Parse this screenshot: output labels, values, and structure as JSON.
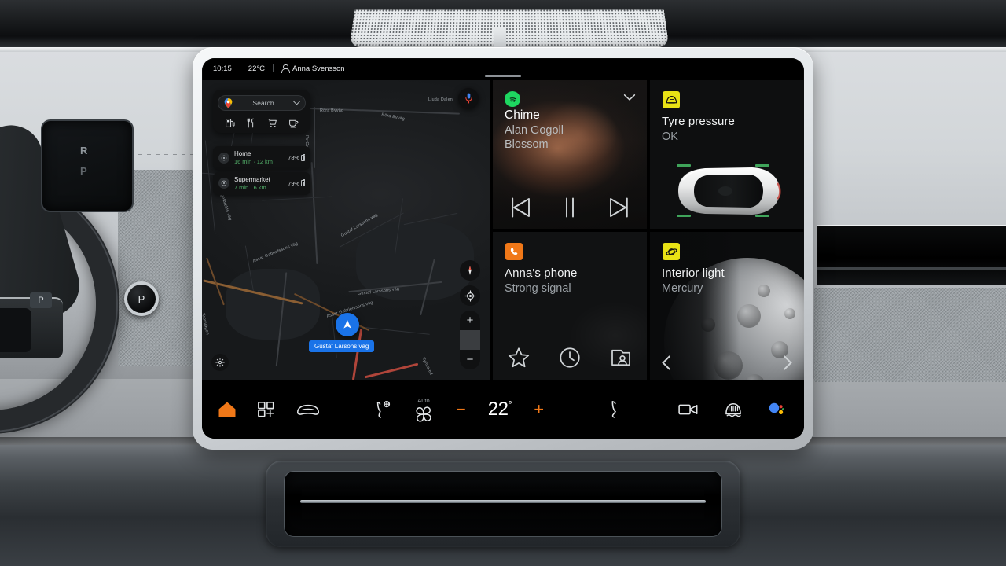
{
  "status_bar": {
    "time": "10:15",
    "temperature": "22°C",
    "profile_name": "Anna Svensson",
    "profile_icon": "person-icon"
  },
  "map": {
    "search": {
      "placeholder": "Search",
      "pin_icon": "google-maps-pin-icon",
      "chevron_icon": "chevron-down-icon"
    },
    "categories": [
      {
        "name": "fuel",
        "icon": "fuel-station-icon"
      },
      {
        "name": "restaurants",
        "icon": "restaurant-icon"
      },
      {
        "name": "shopping",
        "icon": "shopping-cart-icon"
      },
      {
        "name": "coffee",
        "icon": "coffee-cup-icon"
      }
    ],
    "destinations": [
      {
        "title": "Home",
        "eta": "16 min · 12 km",
        "battery": "78%",
        "icon": "destination-pin-icon"
      },
      {
        "title": "Supermarket",
        "eta": "7 min · 6 km",
        "battery": "79%",
        "icon": "destination-pin-icon"
      }
    ],
    "current_road_label": "Gustaf Larsons väg",
    "street_labels": [
      "Röra Byväg",
      "Röra Byväg",
      "Pv Gata",
      "Ljuda Dalen",
      "Gustaf Engelbrekts väg",
      "Gustaf Larssons väg",
      "Gustaf Larssons väg",
      "Assar Gabrielssons väg",
      "Assar Gabrielssons väg",
      "Kronvägen",
      "Tynnered"
    ],
    "mic_icon": "microphone-icon",
    "controls": {
      "compass_icon": "compass-icon",
      "recenter_icon": "recenter-location-icon",
      "zoom_in": "+",
      "zoom_out": "−",
      "settings_icon": "gear-icon"
    }
  },
  "cards": {
    "media": {
      "app_icon": "spotify-icon",
      "title": "Chime",
      "artist": "Alan Gogoll",
      "album": "Blossom",
      "expand_icon": "chevron-down-icon",
      "controls": [
        {
          "name": "previous-track",
          "icon": "skip-previous-icon"
        },
        {
          "name": "pause",
          "icon": "pause-icon"
        },
        {
          "name": "next-track",
          "icon": "skip-next-icon"
        }
      ]
    },
    "tyre": {
      "app_icon": "tyre-pressure-warning-icon",
      "icon_color": "#e8e215",
      "title": "Tyre pressure",
      "status": "OK",
      "tyre_indicator_color": "#3fa45a"
    },
    "phone": {
      "app_icon": "phone-handset-icon",
      "icon_color": "#f07818",
      "title": "Anna's phone",
      "status": "Strong signal",
      "controls": [
        {
          "name": "favourites",
          "icon": "star-icon"
        },
        {
          "name": "recent-calls",
          "icon": "clock-icon"
        },
        {
          "name": "contacts",
          "icon": "contacts-icon"
        }
      ]
    },
    "light": {
      "app_icon": "planet-icon",
      "icon_color": "#e8e215",
      "title": "Interior light",
      "theme": "Mercury",
      "prev_icon": "chevron-left-icon",
      "next_icon": "chevron-right-icon"
    }
  },
  "toolbar": {
    "home_icon": "home-icon",
    "home_color": "#f07818",
    "apps_icon": "apps-grid-icon",
    "car_icon": "car-icon",
    "seat_heat_icon": "seat-heat-icon",
    "fan_icon": "fan-icon",
    "fan_label": "Auto",
    "temp_decrease": "−",
    "temp_value": "22",
    "temp_unit": "°",
    "temp_increase": "+",
    "seat_icon": "seat-icon",
    "camera_icon": "camera-icon",
    "defrost_icon": "rear-defrost-icon",
    "assistant_icon": "google-assistant-icon",
    "accent_color": "#f07818"
  },
  "vehicle": {
    "gear_selector": "P",
    "cluster_gear_top": "R",
    "cluster_gear_bottom": "P"
  }
}
